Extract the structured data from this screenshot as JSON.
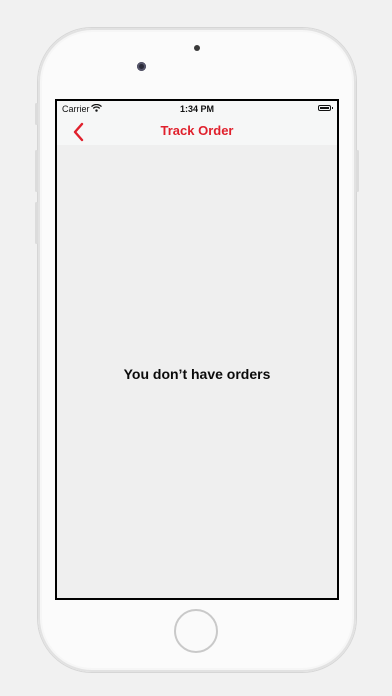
{
  "status_bar": {
    "carrier": "Carrier",
    "time": "1:34 PM",
    "wifi_icon": "wifi-icon",
    "battery_icon": "battery-icon"
  },
  "nav": {
    "title": "Track Order",
    "back_icon": "chevron-left-icon",
    "accent_color": "#e0202c"
  },
  "main": {
    "empty_message": "You don’t have orders"
  }
}
